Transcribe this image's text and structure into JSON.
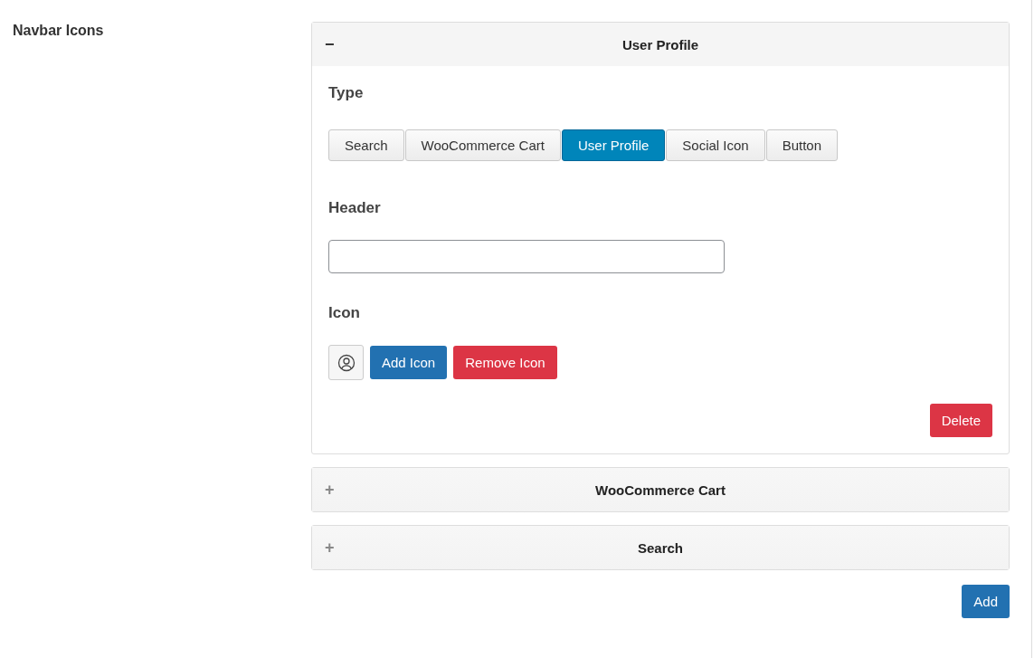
{
  "section_label": "Navbar Icons",
  "panels": [
    {
      "toggle": "−",
      "title": "User Profile",
      "expanded": true,
      "body": {
        "type_label": "Type",
        "types": [
          {
            "label": "Search",
            "selected": false
          },
          {
            "label": "WooCommerce Cart",
            "selected": false
          },
          {
            "label": "User Profile",
            "selected": true
          },
          {
            "label": "Social Icon",
            "selected": false
          },
          {
            "label": "Button",
            "selected": false
          }
        ],
        "header_label": "Header",
        "icon_label": "Icon",
        "add_icon": "Add Icon",
        "remove_icon": "Remove Icon",
        "delete": "Delete"
      }
    },
    {
      "toggle": "+",
      "title": "WooCommerce Cart",
      "expanded": false
    },
    {
      "toggle": "+",
      "title": "Search",
      "expanded": false
    }
  ],
  "add_button": "Add"
}
